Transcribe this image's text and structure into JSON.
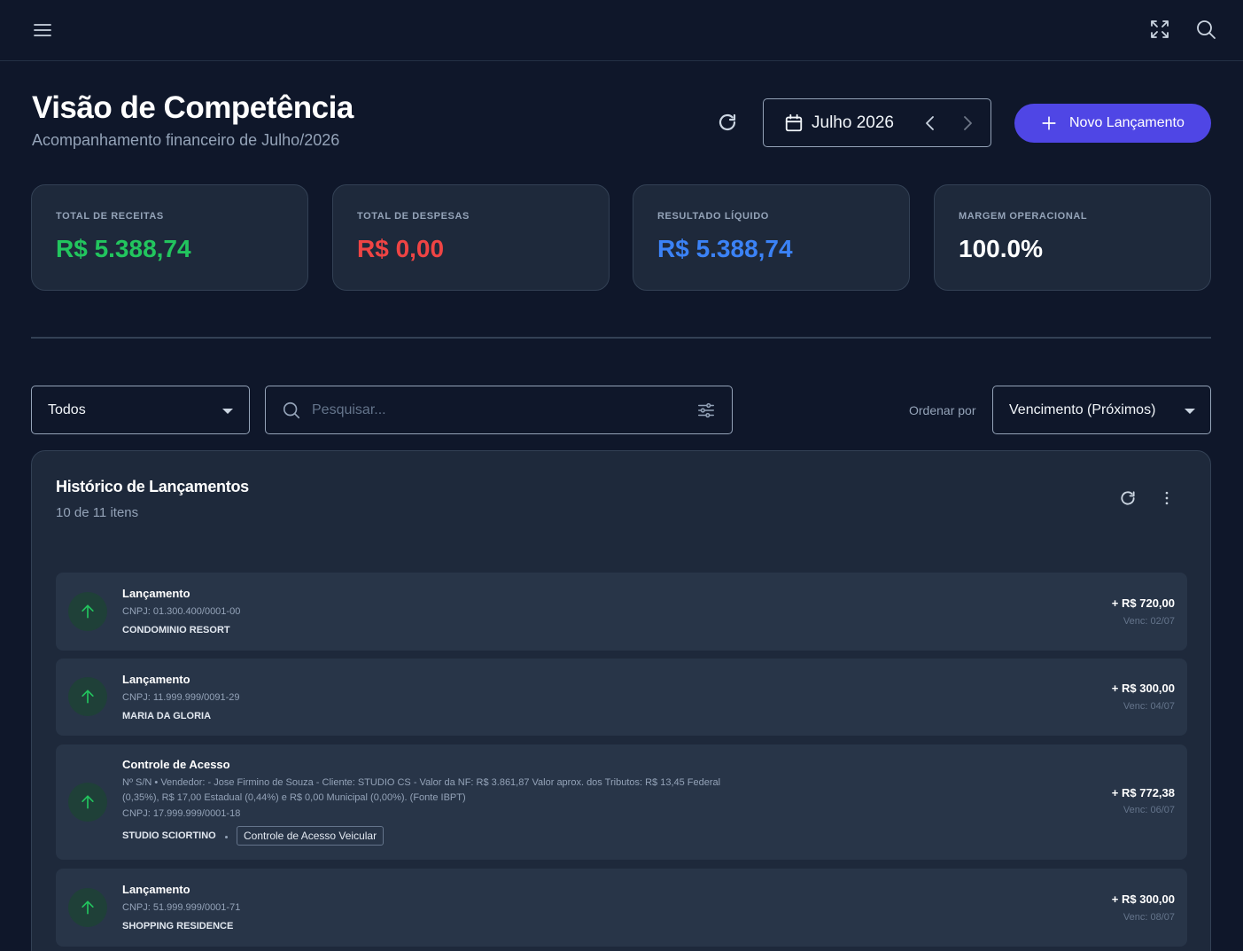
{
  "header": {
    "title": "Visão de Competência",
    "subtitle": "Acompanhamento financeiro de Julho/2026",
    "month_label": "Julho 2026",
    "new_button_label": "Novo Lançamento"
  },
  "summary_cards": [
    {
      "label": "TOTAL DE RECEITAS",
      "value": "R$ 5.388,74",
      "color": "#22c55e"
    },
    {
      "label": "TOTAL DE DESPESAS",
      "value": "R$ 0,00",
      "color": "#ef4444"
    },
    {
      "label": "RESULTADO LÍQUIDO",
      "value": "R$ 5.388,74",
      "color": "#3b82f6"
    },
    {
      "label": "MARGEM OPERACIONAL",
      "value": "100.0%",
      "color": "#ffffff"
    }
  ],
  "filters": {
    "type_selected": "Todos",
    "search_placeholder": "Pesquisar...",
    "order_label": "Ordenar por",
    "order_selected": "Vencimento (Próximos)"
  },
  "history": {
    "title": "Histórico de Lançamentos",
    "count": "10 de 11 itens",
    "items": [
      {
        "title": "Lançamento",
        "cnpj": "CNPJ: 01.300.400/0001-00",
        "client": "CONDOMINIO RESORT",
        "amount": "+ R$ 720,00",
        "due": "Venc: 02/07"
      },
      {
        "title": "Lançamento",
        "cnpj": "CNPJ: 11.999.999/0091-29",
        "client": "MARIA DA GLORIA",
        "amount": "+ R$ 300,00",
        "due": "Venc: 04/07"
      },
      {
        "title": "Controle de Acesso",
        "description": "Nº S/N • Vendedor: - Jose Firmino de Souza - Cliente: STUDIO CS - Valor da NF: R$ 3.861,87 Valor aprox. dos Tributos: R$ 13,45 Federal (0,35%), R$ 17,00 Estadual (0,44%) e R$ 0,00 Municipal (0,00%). (Fonte IBPT)",
        "cnpj": "CNPJ: 17.999.999/0001-18",
        "client": "STUDIO SCIORTINO",
        "tag": "Controle de Acesso Veicular",
        "amount": "+ R$ 772,38",
        "due": "Venc: 06/07"
      },
      {
        "title": "Lançamento",
        "cnpj": "CNPJ: 51.999.999/0001-71",
        "client": "SHOPPING RESIDENCE",
        "amount": "+ R$ 300,00",
        "due": "Venc: 08/07"
      }
    ]
  },
  "icons": {
    "menu": "menu-icon",
    "expand": "expand-icon",
    "search": "search-icon",
    "refresh": "refresh-icon",
    "calendar": "calendar-icon",
    "plus": "plus-icon",
    "filter": "filter-sliders-icon",
    "more": "more-vertical-icon",
    "arrow_up": "arrow-up-icon"
  },
  "colors": {
    "background": "#0f172a",
    "surface": "#1e293b",
    "row": "#283548",
    "accent": "#4f46e5",
    "income": "#22c55e"
  }
}
